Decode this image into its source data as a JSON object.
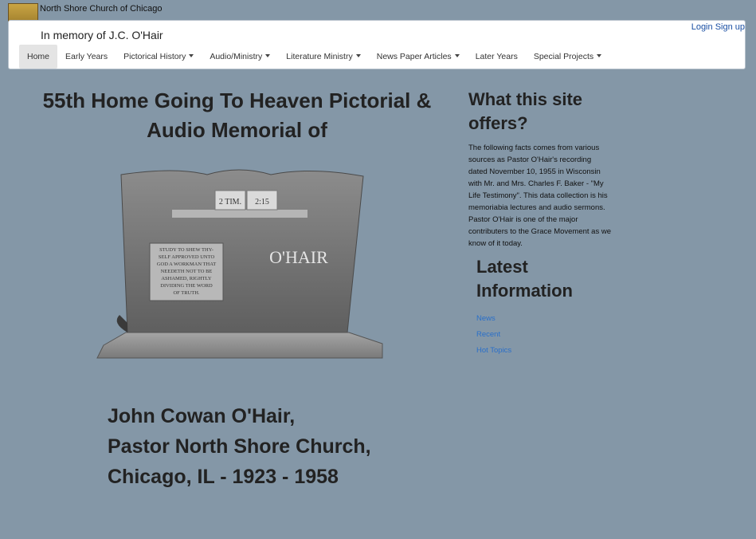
{
  "site": {
    "name": "North Shore Church of Chicago"
  },
  "header": {
    "title": "In memory of J.C. O'Hair",
    "login": "Login",
    "signup": "Sign up"
  },
  "nav": [
    {
      "label": "Home",
      "active": true,
      "dropdown": false
    },
    {
      "label": "Early Years",
      "dropdown": false
    },
    {
      "label": "Pictorical History",
      "dropdown": true
    },
    {
      "label": "Audio/Ministry",
      "dropdown": true
    },
    {
      "label": "Literature Ministry",
      "dropdown": true
    },
    {
      "label": "News Paper Articles",
      "dropdown": true
    },
    {
      "label": "Later Years",
      "dropdown": false
    },
    {
      "label": "Special Projects",
      "dropdown": true
    }
  ],
  "main": {
    "title_line1": "55th Home Going To Heaven Pictorial &",
    "title_line2": "Audio Memorial of",
    "stone": {
      "verse_ref_1": "2 TIM.",
      "verse_ref_2": "2:15",
      "surname": "O'HAIR",
      "verse_lines": [
        "STUDY TO SHEW THY-",
        "SELF APPROVED UNTO",
        "GOD A WORKMAN THAT",
        "NEEDETH NOT TO BE",
        "ASHAMED, RIGHTLY",
        "DIVIDING THE WORD",
        "OF TRUTH."
      ]
    },
    "name_line1": "John Cowan O'Hair,",
    "name_line2": "Pastor North Shore Church,",
    "name_line3": "Chicago, IL - 1923 - 1958"
  },
  "sidebar": {
    "offers_title_line1": "What this site",
    "offers_title_line2": "offers?",
    "offers_text": "The following facts comes from various sources as Pastor O'Hair's recording dated November 10, 1955 in Wisconsin with Mr. and Mrs. Charles F. Baker - \"My Life Testimony\". This data collection is his memoriabia lectures and audio sermons. Pastor O'Hair is one of the major contributers to the Grace Movement as we know of it today.",
    "latest_title_line1": "Latest",
    "latest_title_line2": "Information",
    "links": [
      "News",
      "Recent",
      "Hot Topics"
    ]
  },
  "colors": {
    "background": "#8497a7",
    "link": "#2a6fc9"
  }
}
